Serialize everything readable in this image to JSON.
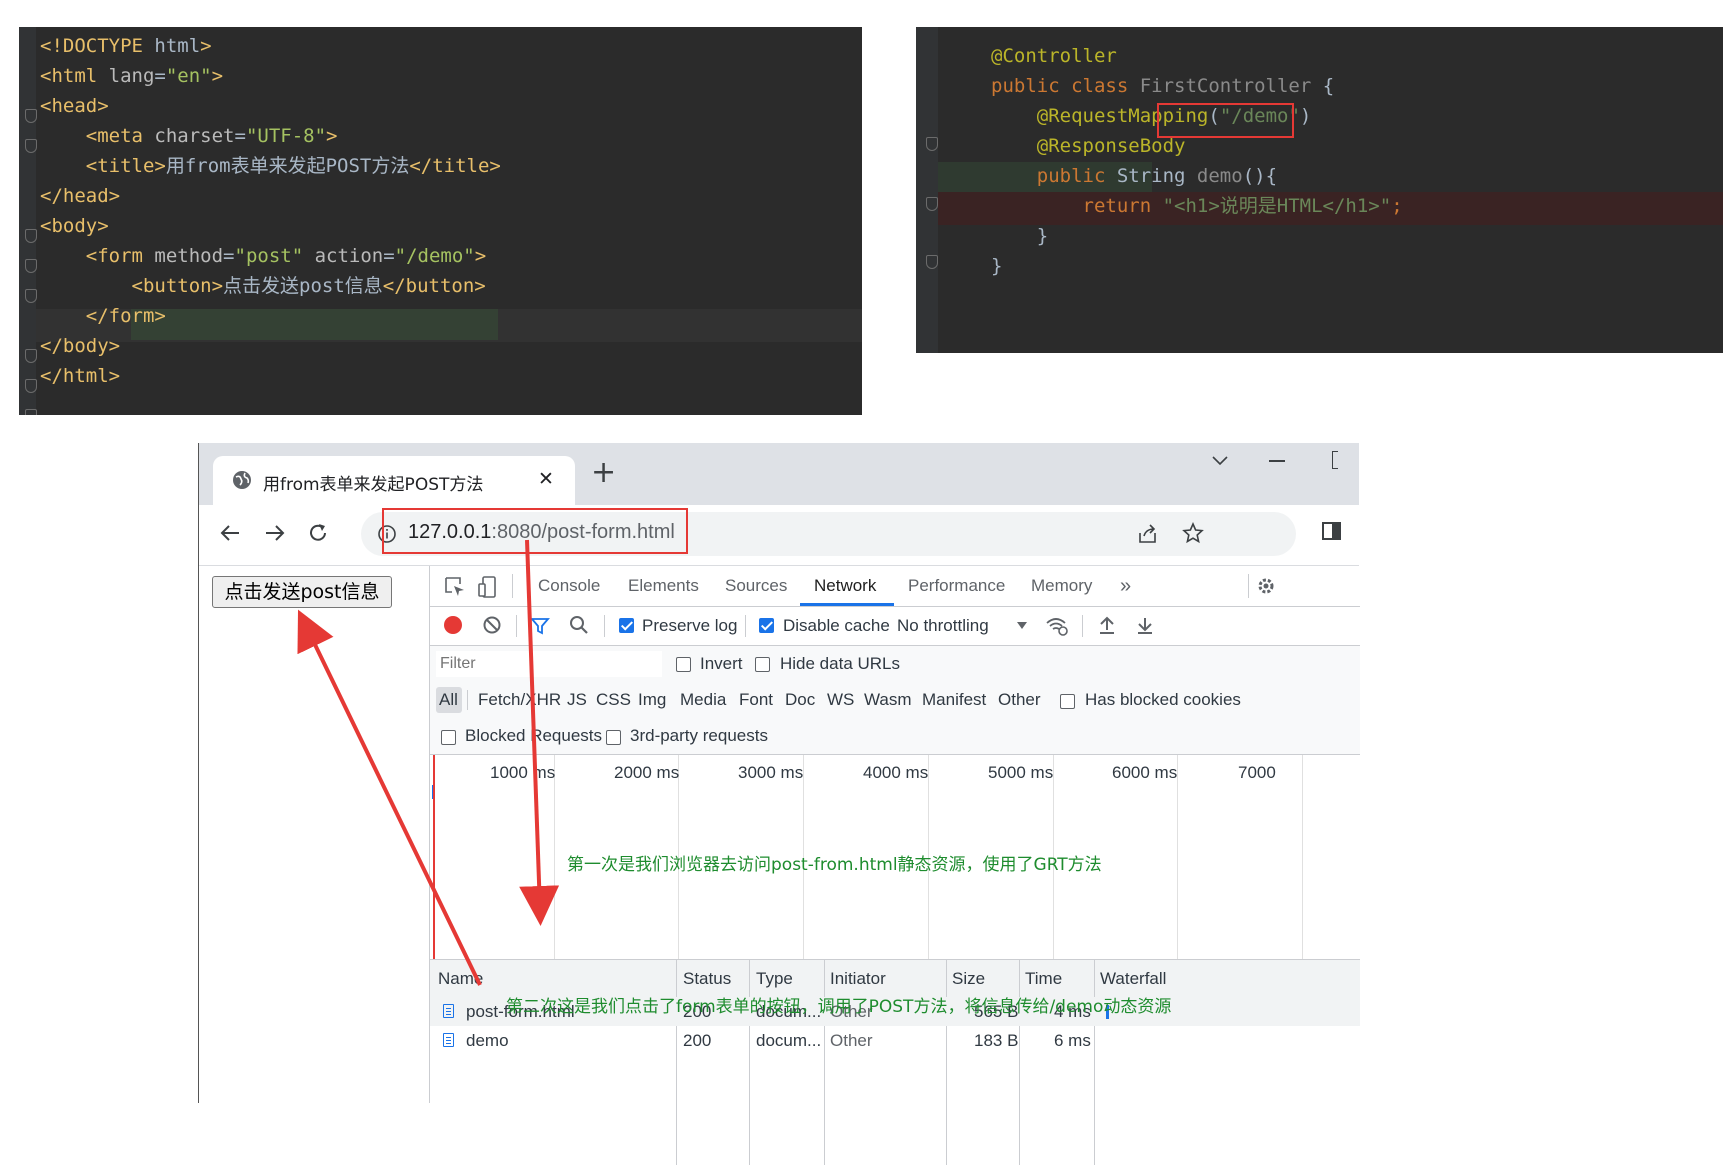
{
  "html_editor": {
    "lines": [
      {
        "parts": [
          [
            "tag",
            "<!DOCTYPE "
          ],
          [
            "txt",
            "html"
          ],
          [
            "tag",
            ">"
          ]
        ]
      },
      {
        "parts": [
          [
            "tag",
            "<html "
          ],
          [
            "attr",
            "lang"
          ],
          [
            "txt",
            "="
          ],
          [
            "val",
            "\"en\""
          ],
          [
            "tag",
            ">"
          ]
        ]
      },
      {
        "parts": [
          [
            "tag",
            "<head>"
          ]
        ]
      },
      {
        "parts": [
          [
            "txt",
            "    "
          ],
          [
            "tag",
            "<meta "
          ],
          [
            "attr",
            "charset"
          ],
          [
            "txt",
            "="
          ],
          [
            "val",
            "\"UTF-8\""
          ],
          [
            "tag",
            ">"
          ]
        ]
      },
      {
        "parts": [
          [
            "txt",
            "    "
          ],
          [
            "tag",
            "<title>"
          ],
          [
            "txt",
            "用from表单来发起POST方法"
          ],
          [
            "tag",
            "</title>"
          ]
        ]
      },
      {
        "parts": [
          [
            "tag",
            "</head>"
          ]
        ]
      },
      {
        "parts": [
          [
            "tag",
            "<body>"
          ]
        ]
      },
      {
        "parts": [
          [
            "txt",
            "    "
          ],
          [
            "tag",
            "<form "
          ],
          [
            "attr",
            "method"
          ],
          [
            "txt",
            "="
          ],
          [
            "val",
            "\"post\" "
          ],
          [
            "attr",
            "action"
          ],
          [
            "txt",
            "="
          ],
          [
            "val",
            "\"/demo\""
          ],
          [
            "tag",
            ">"
          ]
        ]
      },
      {
        "parts": [
          [
            "txt",
            "        "
          ],
          [
            "tag",
            "<button>"
          ],
          [
            "txt",
            "点击发送post信息"
          ],
          [
            "tag",
            "</button>"
          ]
        ]
      },
      {
        "parts": [
          [
            "txt",
            "    "
          ],
          [
            "tag",
            "</form>"
          ]
        ]
      },
      {
        "parts": [
          [
            "tag",
            "</body>"
          ]
        ]
      },
      {
        "parts": [
          [
            "tag",
            "</html>"
          ]
        ]
      }
    ]
  },
  "java_editor": {
    "lines": [
      {
        "parts": [
          [
            "ann",
            "@Controller"
          ]
        ]
      },
      {
        "parts": [
          [
            "kw",
            "public class "
          ],
          [
            "grayname",
            "FirstController "
          ],
          [
            "txt",
            "{"
          ]
        ]
      },
      {
        "parts": [
          [
            "txt",
            "    "
          ],
          [
            "ann",
            "@RequestMapping"
          ],
          [
            "txt",
            "("
          ],
          [
            "str",
            "\"/demo\""
          ],
          [
            "txt",
            ")"
          ]
        ]
      },
      {
        "parts": [
          [
            "txt",
            "    "
          ],
          [
            "ann",
            "@ResponseBody"
          ]
        ]
      },
      {
        "parts": [
          [
            "txt",
            "    "
          ],
          [
            "kw",
            "public "
          ],
          [
            "txt",
            "String "
          ],
          [
            "grayname",
            "demo"
          ],
          [
            "txt",
            "(){"
          ]
        ]
      },
      {
        "parts": [
          [
            "txt",
            "        "
          ],
          [
            "kw",
            "return "
          ],
          [
            "str",
            "\"<h1>说明是HTML</h1>\""
          ],
          [
            "kw",
            ";"
          ]
        ]
      },
      {
        "parts": [
          [
            "txt",
            "    }"
          ]
        ]
      },
      {
        "parts": [
          [
            "txt",
            "}"
          ]
        ]
      }
    ]
  },
  "browser": {
    "tab_title": "用from表单来发起POST方法",
    "tab_close": "✕",
    "new_tab": "+",
    "url_host": "127.0.0.1",
    "url_rest": ":8080/post-form.html",
    "page_button": "点击发送post信息"
  },
  "devtools": {
    "tabs": [
      "Console",
      "Elements",
      "Sources",
      "Network",
      "Performance",
      "Memory"
    ],
    "active_tab": "Network",
    "more": "»",
    "preserve_log": "Preserve log",
    "disable_cache": "Disable cache",
    "throttling": "No throttling",
    "filter_placeholder": "Filter",
    "invert": "Invert",
    "hide_data_urls": "Hide data URLs",
    "types": [
      "All",
      "Fetch/XHR",
      "JS",
      "CSS",
      "Img",
      "Media",
      "Font",
      "Doc",
      "WS",
      "Wasm",
      "Manifest",
      "Other"
    ],
    "has_blocked_cookies": "Has blocked cookies",
    "blocked_requests": "Blocked Requests",
    "third_party": "3rd-party requests",
    "timeline_ticks": [
      "1000 ms",
      "2000 ms",
      "3000 ms",
      "4000 ms",
      "5000 ms",
      "6000 ms",
      "7000"
    ],
    "columns": [
      "Name",
      "Status",
      "Type",
      "Initiator",
      "Size",
      "Time",
      "Waterfall"
    ],
    "rows": [
      {
        "name": "post-form.html",
        "status": "200",
        "type": "docum...",
        "initiator": "Other",
        "size": "565 B",
        "time": "4 ms"
      },
      {
        "name": "demo",
        "status": "200",
        "type": "docum...",
        "initiator": "Other",
        "size": "183 B",
        "time": "6 ms"
      }
    ]
  },
  "annotations": {
    "first": "第一次是我们浏览器去访问post-from.html静态资源，使用了GRT方法",
    "second": "第二次这是我们点击了form表单的按钮，调用了POST方法，将信息传给/demo动态资源"
  },
  "colors": {
    "editor_bg": "#2b2b2b",
    "annotation_red": "#e53935",
    "note_green": "#1e8c2e",
    "record_red": "#e53935",
    "accent_blue": "#1a73e8"
  }
}
